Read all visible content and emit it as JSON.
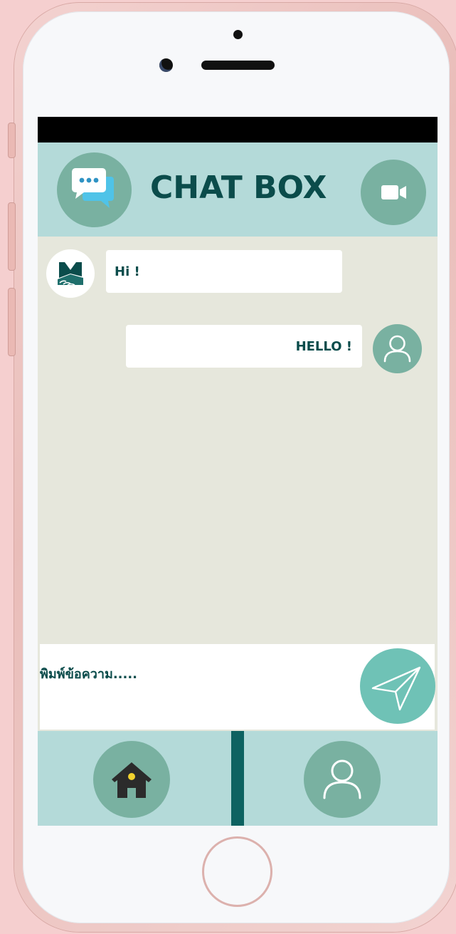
{
  "header": {
    "title": "CHAT BOX",
    "chat_icon": "chat-bubbles-icon",
    "video_icon": "video-camera-icon"
  },
  "messages": [
    {
      "from": "bot",
      "text": "Hi !",
      "avatar_icon": "bot-logo-icon"
    },
    {
      "from": "user",
      "text": "HELLO !",
      "avatar_icon": "user-icon"
    }
  ],
  "composer": {
    "placeholder": "พิมพ์ข้อความ.....",
    "send_icon": "send-icon"
  },
  "bottom_nav": {
    "items": [
      {
        "icon": "home-icon"
      },
      {
        "icon": "profile-icon"
      }
    ]
  },
  "colors": {
    "accent_dark": "#0b4c4b",
    "header_bg": "#b4dad9",
    "chat_bg": "#e6e7dc",
    "circle_btn": "#79b1a1",
    "send_btn": "#6fc2b6",
    "nav_divider": "#0d6261"
  }
}
